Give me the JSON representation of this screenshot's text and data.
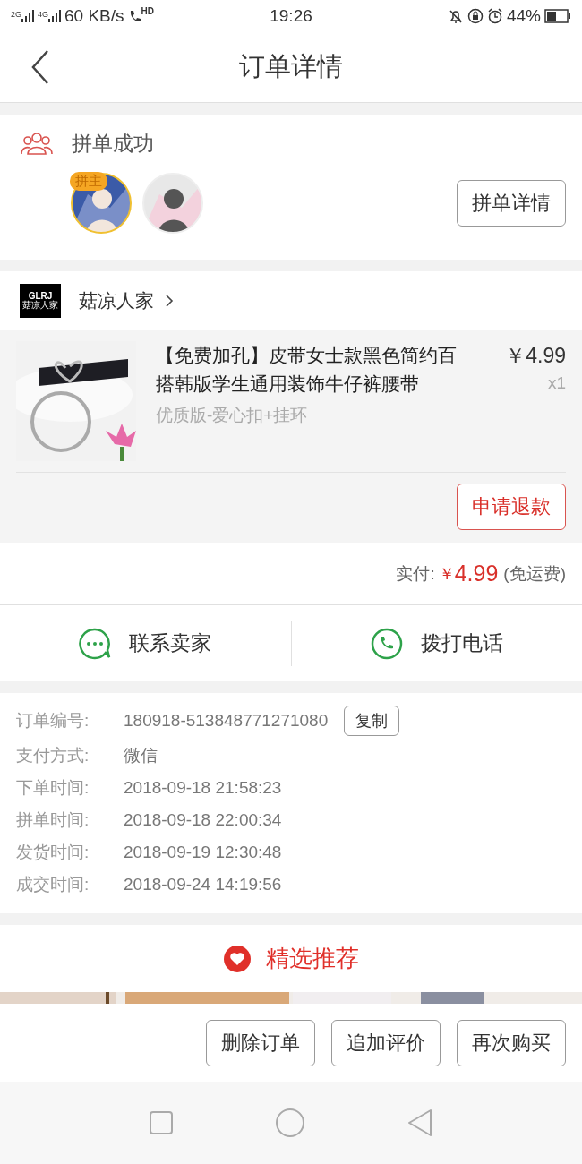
{
  "status_bar": {
    "network_1": "2G",
    "network_2": "4G",
    "speed": "60 KB/s",
    "call_badge": "HD",
    "time": "19:26",
    "battery": "44%"
  },
  "header": {
    "title": "订单详情"
  },
  "group_buy": {
    "status": "拼单成功",
    "leader_badge": "拼主",
    "members": [
      {
        "leader": true
      },
      {
        "leader": false
      }
    ],
    "details_button": "拼单详情"
  },
  "shop": {
    "logo_line_1": "GLRJ",
    "logo_line_2": "菇凉人家",
    "name": "菇凉人家"
  },
  "product": {
    "title": "【免费加孔】皮带女士款黑色简约百搭韩版学生通用装饰牛仔裤腰带",
    "price": "￥4.99",
    "quantity": "x1",
    "variant": "优质版-爱心扣+挂环",
    "refund_button": "申请退款"
  },
  "payment": {
    "label": "实付:",
    "amount_symbol": "￥",
    "amount": "4.99",
    "note": "(免运费)"
  },
  "contact": [
    {
      "kind": "chat",
      "label": "联系卖家"
    },
    {
      "kind": "phone",
      "label": "拨打电话"
    }
  ],
  "order_info": [
    {
      "label": "订单编号:",
      "value": "180918-513848771271080",
      "action": "复制"
    },
    {
      "label": "支付方式:",
      "value": "微信"
    },
    {
      "label": "下单时间:",
      "value": "2018-09-18 21:58:23"
    },
    {
      "label": "拼单时间:",
      "value": "2018-09-18 22:00:34"
    },
    {
      "label": "发货时间:",
      "value": "2018-09-19 12:30:48"
    },
    {
      "label": "成交时间:",
      "value": "2018-09-24 14:19:56"
    }
  ],
  "recommend": {
    "title": "精选推荐"
  },
  "actions": [
    "删除订单",
    "追加评价",
    "再次购买"
  ]
}
